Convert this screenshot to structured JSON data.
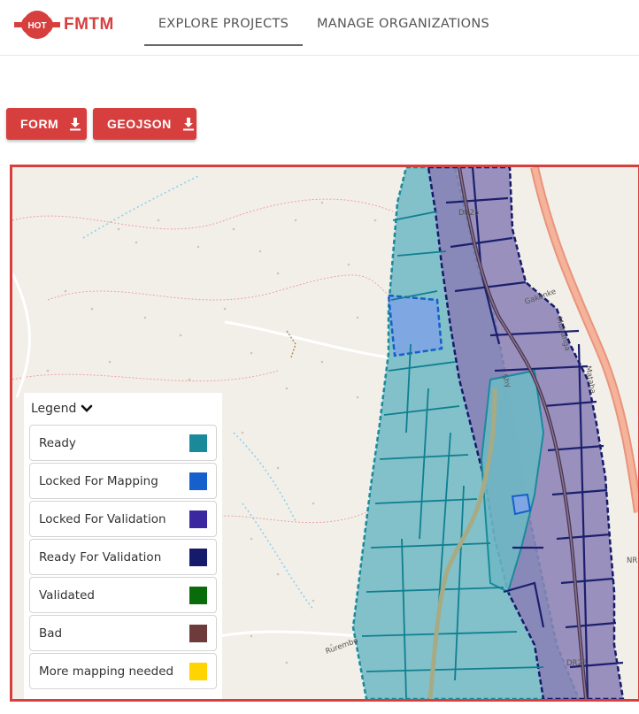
{
  "header": {
    "logo_badge": "HOT",
    "logo_text": "FMTM",
    "tabs": [
      {
        "label": "EXPLORE PROJECTS",
        "active": true
      },
      {
        "label": "MANAGE ORGANIZATIONS",
        "active": false
      }
    ]
  },
  "toolbar": {
    "form_label": "FORM",
    "geojson_label": "GEOJSON",
    "download_icon": "download-icon"
  },
  "map": {
    "road_labels": [
      "DR25",
      "Gakenke",
      "Muhanga",
      "Mataba",
      "Shy",
      "Rurembo",
      "DR25",
      "NR"
    ]
  },
  "legend": {
    "title": "Legend",
    "items": [
      {
        "label": "Ready",
        "color": "#1a8a9b"
      },
      {
        "label": "Locked For Mapping",
        "color": "#1560cc"
      },
      {
        "label": "Locked For Validation",
        "color": "#3b27a0"
      },
      {
        "label": "Ready For Validation",
        "color": "#161a6a"
      },
      {
        "label": "Validated",
        "color": "#0a6b0a"
      },
      {
        "label": "Bad",
        "color": "#6d3b3b"
      },
      {
        "label": "More mapping needed",
        "color": "#ffd400"
      }
    ]
  },
  "colors": {
    "brand": "#d73f3f",
    "ready_fill": "#6fb8c4",
    "validation_fill": "#8a7fb5",
    "locked_mapping_fill": "#7ea6e3"
  }
}
